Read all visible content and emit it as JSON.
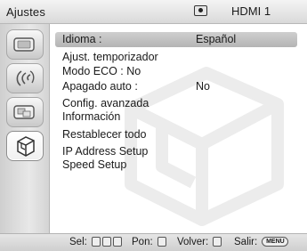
{
  "header": {
    "title": "Ajustes",
    "input_icon": "input-source-icon",
    "input_name": "HDMI 1"
  },
  "sidebar": {
    "items": [
      {
        "icon": "picture-icon",
        "active": false
      },
      {
        "icon": "sound-icon",
        "active": false
      },
      {
        "icon": "screen-icon",
        "active": false
      },
      {
        "icon": "setup-box-icon",
        "active": true
      }
    ]
  },
  "menu": {
    "items": [
      {
        "label": "Idioma :",
        "value": "Español",
        "selected": true
      },
      {
        "label": "Ajust. temporizador",
        "value": ""
      },
      {
        "label": "Modo ECO : No",
        "value": ""
      },
      {
        "label": "Apagado auto :",
        "value": "No"
      },
      {
        "label": "Config. avanzada",
        "value": ""
      },
      {
        "label": "Información",
        "value": ""
      },
      {
        "label": "Restablecer todo",
        "value": ""
      },
      {
        "label": "IP Address Setup",
        "value": ""
      },
      {
        "label": "Speed Setup",
        "value": ""
      }
    ]
  },
  "footer": {
    "select_label": "Sel:",
    "enter_label": "Pon:",
    "back_label": "Volver:",
    "exit_label": "Salir:",
    "menu_button": "MENU"
  },
  "colors": {
    "selection": "#c2c2c2",
    "background": "#ffffff",
    "sidebar": "#dcdcdc"
  }
}
